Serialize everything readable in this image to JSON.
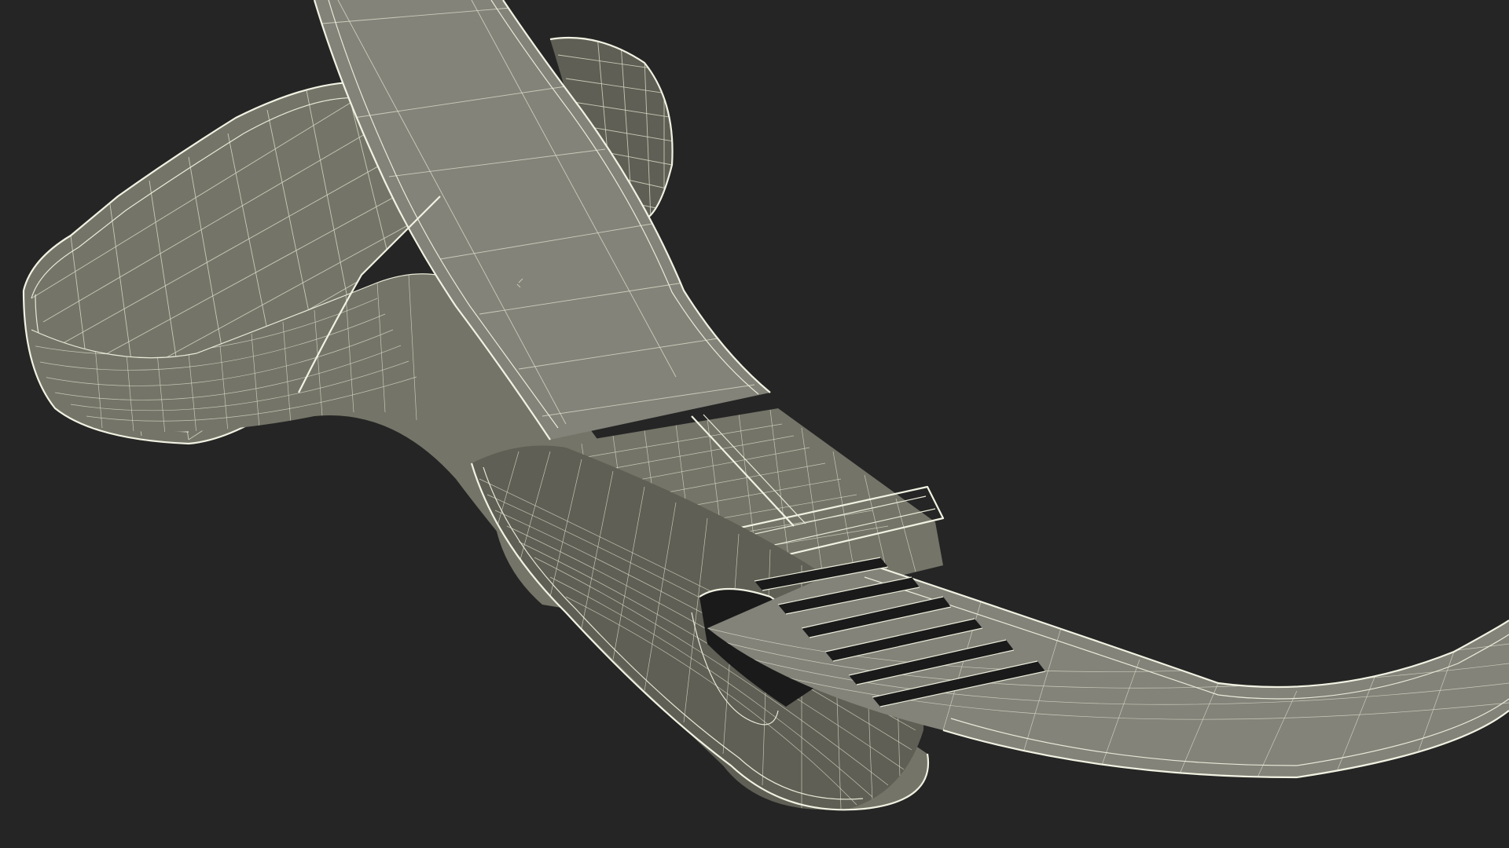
{
  "scene": {
    "background_color": "#252525",
    "mesh_color": "#747468",
    "wireframe_color": "#e9ead8",
    "object": "strap-with-buckle-wireframe-model"
  }
}
